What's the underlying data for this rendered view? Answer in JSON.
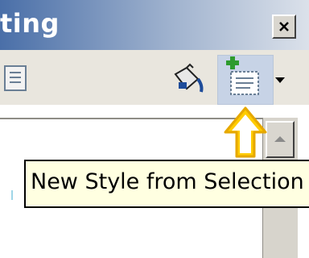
{
  "window": {
    "title": "ting"
  },
  "toolbar": {
    "new_style_button_active": true
  },
  "tooltip": {
    "text": "New Style from Selection"
  },
  "colors": {
    "title_gradient_start": "#4a6fa8",
    "title_text": "#ffffff",
    "toolbar_bg": "#e9e6de",
    "button_hover_bg": "#c7d3e6",
    "tooltip_bg": "#ffffe1",
    "arrow_fill": "#ffcc00",
    "arrow_stroke": "#e6a800"
  },
  "icons": [
    "close-icon",
    "document-icon",
    "fill-format-icon",
    "new-style-from-selection-icon",
    "dropdown-arrow-icon",
    "scroll-up-icon",
    "highlight-arrow-icon"
  ]
}
